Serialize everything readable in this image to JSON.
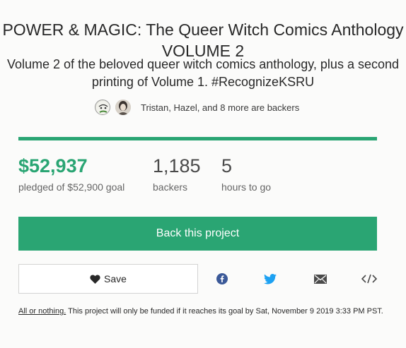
{
  "project": {
    "title": "POWER & MAGIC: The Queer Witch Comics Anthology VOLUME 2",
    "blurb": "Volume 2 of the beloved queer witch comics anthology, plus a second printing of Volume 1. #RecognizeKSRU"
  },
  "backers_row": {
    "text": "Tristan, Hazel, and 8 more are backers",
    "avatars": [
      "backer-avatar-1",
      "backer-avatar-2"
    ]
  },
  "progress": {
    "fraction": 1.0,
    "color": "#2aa573"
  },
  "stats": {
    "pledged_value": "$52,937",
    "pledged_label": "pledged of $52,900 goal",
    "backers_value": "1,185",
    "backers_label": "backers",
    "time_value": "5",
    "time_label": "hours to go"
  },
  "actions": {
    "back_label": "Back this project",
    "save_label": "Save",
    "share_icons": [
      "facebook-icon",
      "twitter-icon",
      "email-icon",
      "embed-icon"
    ]
  },
  "note": {
    "link_text": "All or nothing.",
    "text": " This project will only be funded if it reaches its goal by Sat, November 9 2019 3:33 PM PST."
  },
  "colors": {
    "accent": "#2aa573",
    "text": "#282828",
    "muted": "#656565",
    "facebook": "#3b5998",
    "twitter": "#1da1f2"
  }
}
